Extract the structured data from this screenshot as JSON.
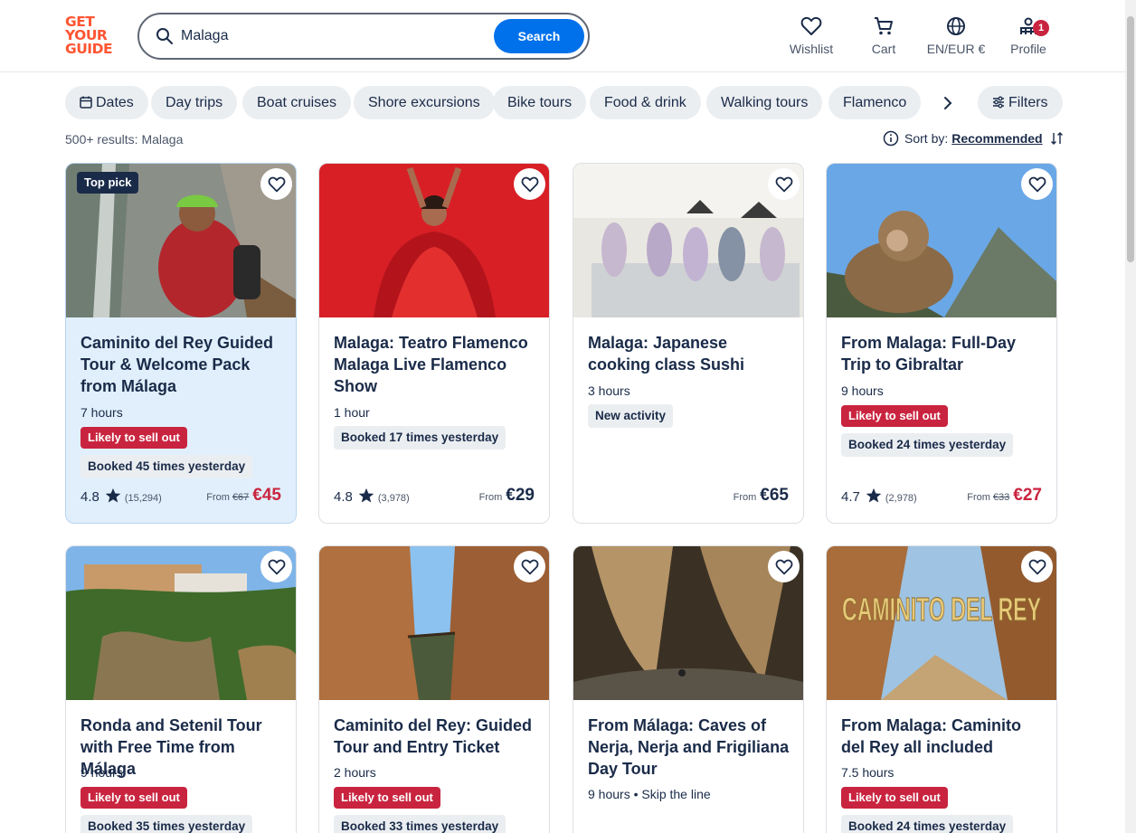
{
  "header": {
    "logo": [
      "GET",
      "YOUR",
      "GUIDE"
    ],
    "search_value": "Malaga",
    "search_button": "Search",
    "nav": [
      {
        "label": "Wishlist",
        "icon": "heart-icon"
      },
      {
        "label": "Cart",
        "icon": "cart-icon"
      },
      {
        "label": "EN/EUR €",
        "icon": "globe-icon"
      },
      {
        "label": "Profile",
        "icon": "profile-icon",
        "badge": "1"
      }
    ]
  },
  "chips": [
    "Dates",
    "Day trips",
    "Boat cruises",
    "Shore excursions",
    "Bike tours",
    "Food & drink",
    "Walking tours",
    "Flamenco"
  ],
  "filters_label": "Filters",
  "results_text": "500+ results: Malaga",
  "sort": {
    "label": "Sort by:",
    "value": "Recommended"
  },
  "colors": {
    "brand": "#ff5533",
    "primary": "#0071eb",
    "danger": "#c9243f",
    "text": "#1a2b49",
    "highlight": "#e1effc"
  },
  "cards": [
    {
      "title": "Caminito del Rey Guided Tour & Welcome Pack from Málaga",
      "duration": "7 hours",
      "top_pick": "Top pick",
      "sell_out": "Likely to sell out",
      "booked": "Booked 45 times yesterday",
      "rating": "4.8",
      "reviews": "(15,294)",
      "from": "From",
      "old_price": "€67",
      "price": "€45"
    },
    {
      "title": "Malaga: Teatro Flamenco Malaga Live Flamenco Show",
      "duration": "1 hour",
      "booked": "Booked 17 times yesterday",
      "rating": "4.8",
      "reviews": "(3,978)",
      "from": "From",
      "price": "€29"
    },
    {
      "title": "Malaga: Japanese cooking class Sushi",
      "duration": "3 hours",
      "new_activity": "New activity",
      "from": "From",
      "price": "€65"
    },
    {
      "title": "From Malaga: Full-Day Trip to Gibraltar",
      "duration": "9 hours",
      "sell_out": "Likely to sell out",
      "booked": "Booked 24 times yesterday",
      "rating": "4.7",
      "reviews": "(2,978)",
      "from": "From",
      "old_price": "€33",
      "price": "€27"
    },
    {
      "title": "Ronda and Setenil Tour with Free Time from Málaga",
      "duration": "9 hours",
      "sell_out": "Likely to sell out",
      "booked": "Booked 35 times yesterday"
    },
    {
      "title": "Caminito del Rey: Guided Tour and Entry Ticket",
      "duration": "2 hours",
      "sell_out": "Likely to sell out",
      "booked": "Booked 33 times yesterday"
    },
    {
      "title": "From Málaga: Caves of Nerja, Nerja and Frigiliana Day Tour",
      "duration": "9 hours • Skip the line"
    },
    {
      "title": "From Malaga: Caminito del Rey all included",
      "duration": "7.5 hours",
      "sell_out": "Likely to sell out",
      "booked": "Booked 24 times yesterday",
      "image_text": "CAMINITO DEL REY"
    }
  ]
}
